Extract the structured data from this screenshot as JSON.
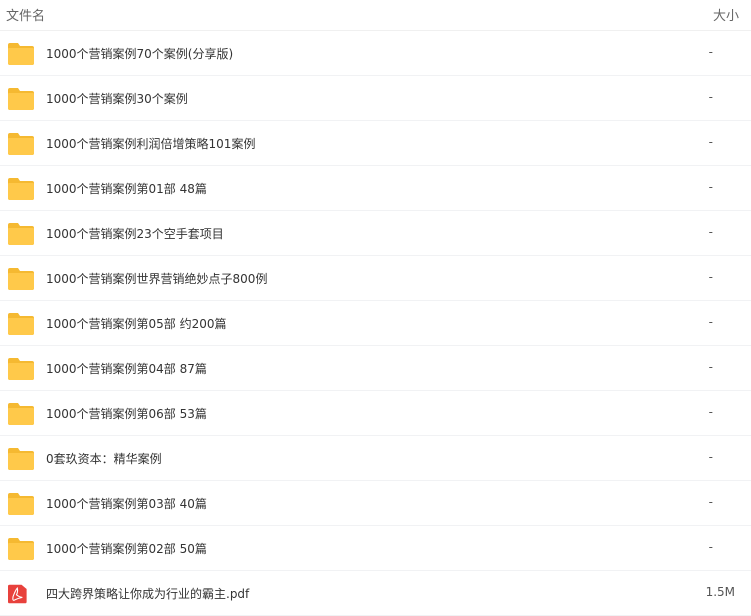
{
  "header": {
    "name_label": "文件名",
    "size_label": "大小"
  },
  "files": [
    {
      "name": "1000个营销案例70个案例(分享版)",
      "size": "-",
      "icon": "folder-icon"
    },
    {
      "name": "1000个营销案例30个案例",
      "size": "-",
      "icon": "folder-icon"
    },
    {
      "name": "1000个营销案例利润倍增策略101案例",
      "size": "-",
      "icon": "folder-icon"
    },
    {
      "name": "1000个营销案例第01部 48篇",
      "size": "-",
      "icon": "folder-icon"
    },
    {
      "name": "1000个营销案例23个空手套项目",
      "size": "-",
      "icon": "folder-icon"
    },
    {
      "name": "1000个营销案例世界营销绝妙点子800例",
      "size": "-",
      "icon": "folder-icon"
    },
    {
      "name": "1000个营销案例第05部 约200篇",
      "size": "-",
      "icon": "folder-icon"
    },
    {
      "name": "1000个营销案例第04部 87篇",
      "size": "-",
      "icon": "folder-icon"
    },
    {
      "name": "1000个营销案例第06部 53篇",
      "size": "-",
      "icon": "folder-icon"
    },
    {
      "name": "0套玖资本：精华案例",
      "size": "-",
      "icon": "folder-icon"
    },
    {
      "name": "1000个营销案例第03部 40篇",
      "size": "-",
      "icon": "folder-icon"
    },
    {
      "name": "1000个营销案例第02部 50篇",
      "size": "-",
      "icon": "folder-icon"
    },
    {
      "name": "四大跨界策略让你成为行业的霸主.pdf",
      "size": "1.5M",
      "icon": "pdf-icon"
    }
  ],
  "colors": {
    "folder": "#ffc94a",
    "folder_tab": "#f5b931",
    "pdf": "#e8413c"
  }
}
